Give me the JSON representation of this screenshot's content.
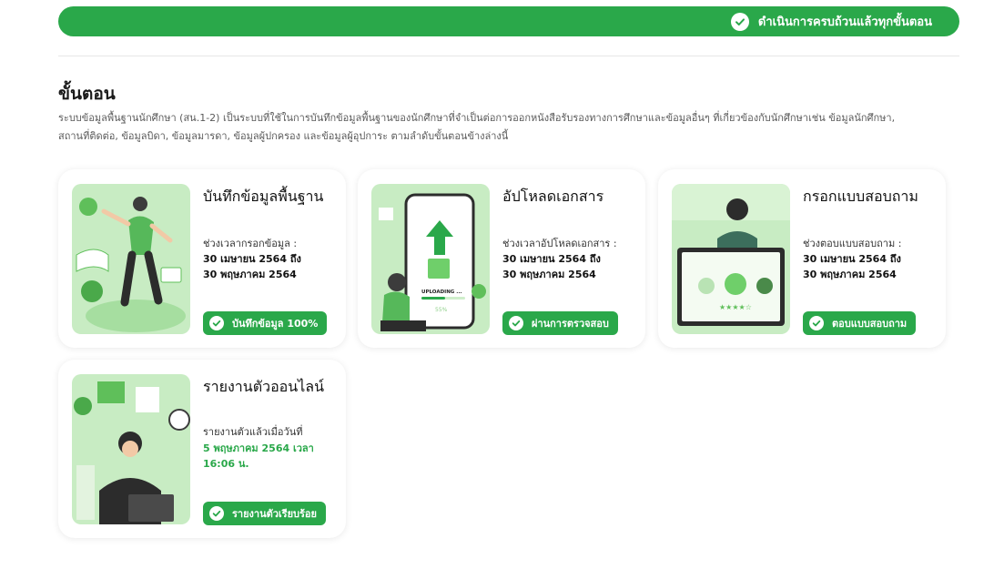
{
  "banner": {
    "label": "ดำเนินการครบถ้วนแล้วทุกขั้นตอน",
    "icon": "check-circle-icon"
  },
  "steps": {
    "title": "ขั้นตอน",
    "description_line1": "ระบบข้อมูลพื้นฐานนักศึกษา (สน.1-2) เป็นระบบที่ใช้ในการบันทึกข้อมูลพื้นฐานของนักศึกษาที่จำเป็นต่อการออกหนังสือรับรองทางการศึกษาและข้อมูลอื่นๆ ที่เกี่ยวข้องกับนักศึกษาเช่น ข้อมูลนักศึกษา,",
    "description_line2": "สถานที่ติดต่อ, ข้อมูลบิดา, ข้อมูลมารดา, ข้อมูลผู้ปกครอง และข้อมูลผู้อุปการะ ตามลำดับขั้นตอนข้างล่างนี้"
  },
  "cards": [
    {
      "title": "บันทึกข้อมูลพื้นฐาน",
      "info_label": "ช่วงเวลากรอกข้อมูล :",
      "line1": "30 เมษายน 2564 ถึง",
      "line2": "30 พฤษภาคม 2564",
      "button": "บันทึกข้อมูล 100%"
    },
    {
      "title": "อัปโหลดเอกสาร",
      "info_label": "ช่วงเวลาอัปโหลดเอกสาร :",
      "line1": "30 เมษายน 2564 ถึง",
      "line2": "30 พฤษภาคม 2564",
      "button": "ผ่านการตรวจสอบ",
      "illus_text": "UPLOADING ...",
      "illus_percent": "55%"
    },
    {
      "title": "กรอกแบบสอบถาม",
      "info_label": "ช่วงตอบแบบสอบถาม :",
      "line1": "30 เมษายน 2564 ถึง",
      "line2": "30 พฤษภาคม 2564",
      "button": "ตอบแบบสอบถาม"
    },
    {
      "title": "รายงานตัวออนไลน์",
      "info_label": "รายงานตัวแล้วเมื่อวันที่",
      "line1": "5 พฤษภาคม 2564 เวลา",
      "line2": "16:06 น.",
      "button": "รายงานตัวเรียบร้อย"
    }
  ],
  "colors": {
    "accent": "#2aa84a",
    "illus_bg": "#c8ecc3",
    "illus_dark": "#2c2c2c"
  }
}
